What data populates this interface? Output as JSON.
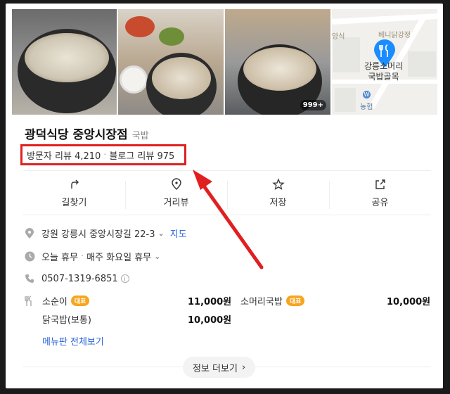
{
  "photos": {
    "badge": "999+",
    "map_labels": {
      "poi": "강릉소머리\n국밥골목",
      "place1": "양식",
      "place2": "베니닭강정",
      "bank": "농협",
      "bank_icon": "W"
    }
  },
  "place": {
    "name": "광덕식당 중앙시장점",
    "category": "국밥",
    "visitor_reviews": "방문자 리뷰 4,210",
    "sep": "·",
    "blog_reviews": "블로그 리뷰 975"
  },
  "actions": [
    {
      "label": "길찾기",
      "icon": "directions-icon"
    },
    {
      "label": "거리뷰",
      "icon": "streetview-pin-icon"
    },
    {
      "label": "저장",
      "icon": "star-icon"
    },
    {
      "label": "공유",
      "icon": "share-icon"
    }
  ],
  "info": {
    "address": "강원 강릉시 중앙시장길 22-3",
    "map_link": "지도",
    "hours_status": "오늘 휴무",
    "hours_sep": "·",
    "hours_detail": "매주 화요일 휴무",
    "phone": "0507-1319-6851",
    "info_icon": "i",
    "chevron": "⌄"
  },
  "menu": {
    "items": [
      {
        "name": "소순이",
        "badge": "대표",
        "price": "11,000원"
      },
      {
        "name": "소머리국밥",
        "badge": "대표",
        "price": "10,000원"
      },
      {
        "name": "닭국밥(보통)",
        "badge": "",
        "price": "10,000원"
      }
    ],
    "view_all": "메뉴판 전체보기"
  },
  "more_button": {
    "label": "정보 더보기",
    "chevron": "›"
  },
  "colors": {
    "accent": "#2762d8",
    "highlight": "#e02020",
    "badge": "#f7a51e",
    "pin": "#1a8cff"
  }
}
